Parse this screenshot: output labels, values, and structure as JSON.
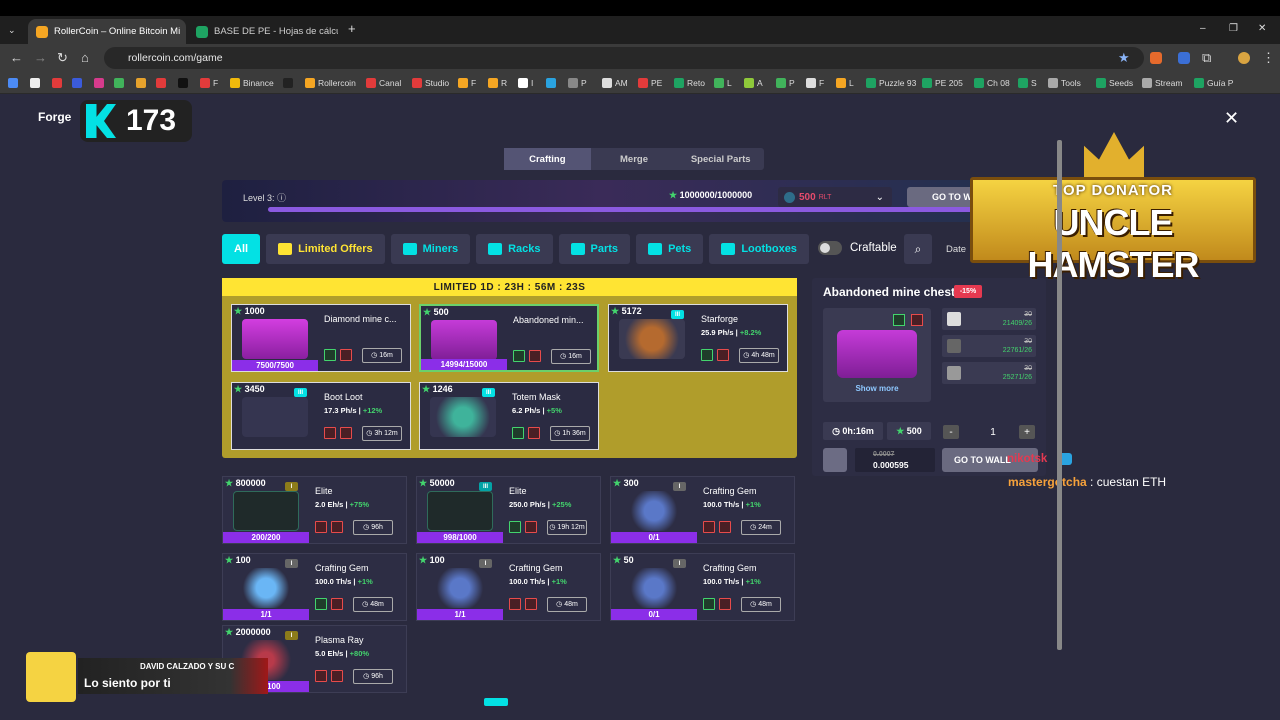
{
  "browser": {
    "tabs": [
      {
        "title": "RollerCoin – Online Bitcoin Mi",
        "active": true
      },
      {
        "title": "BASE DE PE - Hojas de cálculo",
        "active": false
      }
    ],
    "url": "rollercoin.com/game",
    "bookmarks": [
      "Binance",
      "Rollercoin",
      "Canal",
      "Studio",
      "F",
      "R",
      "I",
      "P",
      "AM",
      "PE",
      "Reto",
      "L",
      "A",
      "P",
      "F",
      "L",
      "Puzzle 93",
      "PE 205",
      "Ch 08",
      "S",
      "Tools",
      "Seeds",
      "Stream",
      "Guía P"
    ]
  },
  "forge": {
    "title": "Forge",
    "count": "173"
  },
  "subtabs": [
    "Crafting",
    "Merge",
    "Special Parts"
  ],
  "level": {
    "label": "Level 3:",
    "points": "1000000/1000000",
    "rlt_amount": "500",
    "rlt_unit": "RLT",
    "go_label": "GO TO W"
  },
  "filters": [
    "All",
    "Limited Offers",
    "Miners",
    "Racks",
    "Parts",
    "Pets",
    "Lootboxes"
  ],
  "craftable_label": "Craftable",
  "date_label": "Date",
  "limited": {
    "header": "LIMITED 1D : 23H : 56M : 23S",
    "cards": [
      {
        "pts": "1000",
        "title": "Diamond mine c...",
        "bar": "7500/7500",
        "time": "16m"
      },
      {
        "pts": "500",
        "title": "Abandoned min...",
        "bar": "14994/15000",
        "time": "16m"
      },
      {
        "pts": "5172",
        "title": "Starforge",
        "stat": "25.9 Ph/s",
        "bonus": "+8.2%",
        "time": "4h 48m",
        "badge": "III"
      },
      {
        "pts": "3450",
        "title": "Boot Loot",
        "stat": "17.3 Ph/s",
        "bonus": "+12%",
        "time": "3h 12m",
        "badge": "III"
      },
      {
        "pts": "1246",
        "title": "Totem Mask",
        "stat": "6.2 Ph/s",
        "bonus": "+5%",
        "time": "1h 36m",
        "badge": "III"
      }
    ]
  },
  "items": [
    {
      "pts": "800000",
      "title": "Elite",
      "stat": "2.0 Eh/s",
      "bonus": "+75%",
      "time": "96h",
      "bar": "200/200",
      "badge": "I"
    },
    {
      "pts": "50000",
      "title": "Elite",
      "stat": "250.0 Ph/s",
      "bonus": "+25%",
      "time": "19h 12m",
      "bar": "998/1000",
      "badge": "III"
    },
    {
      "pts": "300",
      "title": "Crafting Gem",
      "stat": "100.0 Th/s",
      "bonus": "+1%",
      "time": "24m",
      "bar": "0/1",
      "badge": "I"
    },
    {
      "pts": "100",
      "title": "Crafting Gem",
      "stat": "100.0 Th/s",
      "bonus": "+1%",
      "time": "48m",
      "bar": "1/1",
      "badge": "I"
    },
    {
      "pts": "100",
      "title": "Crafting Gem",
      "stat": "100.0 Th/s",
      "bonus": "+1%",
      "time": "48m",
      "bar": "1/1",
      "badge": "I"
    },
    {
      "pts": "50",
      "title": "Crafting Gem",
      "stat": "100.0 Th/s",
      "bonus": "+1%",
      "time": "48m",
      "bar": "0/1",
      "badge": "I"
    },
    {
      "pts": "2000000",
      "title": "Plasma Ray",
      "stat": "5.0 Eh/s",
      "bonus": "+80%",
      "time": "96h",
      "bar": "100/100",
      "badge": "I"
    }
  ],
  "detail": {
    "title": "Abandoned mine chest",
    "tag": "-15%",
    "show_more": "Show more",
    "parts": [
      {
        "need": "30",
        "have": "21409/26"
      },
      {
        "need": "30",
        "have": "22761/26"
      },
      {
        "need": "30",
        "have": "25271/26"
      }
    ],
    "time": "0h:16m",
    "pts": "500",
    "qty": "1",
    "minus": "-",
    "plus": "+",
    "cost_old": "0.0007",
    "cost": "0.000595",
    "go_label": "GO TO WALL"
  },
  "chat": {
    "line1_user": "nikotsk",
    "line2_user": "mastergotcha",
    "line2_text": ": cuestan ETH"
  },
  "donator": {
    "line1": "TOP DONATOR",
    "line2": "UNCLE HAMSTER"
  },
  "overlay": {
    "artist": "DAVID CALZADO Y SU C",
    "song": "Lo siento por ti"
  },
  "colors": {
    "accent": "#03e1e4",
    "limited_header": "#ffe433",
    "progress": "#8b2ee8",
    "positive": "#43d46d"
  }
}
